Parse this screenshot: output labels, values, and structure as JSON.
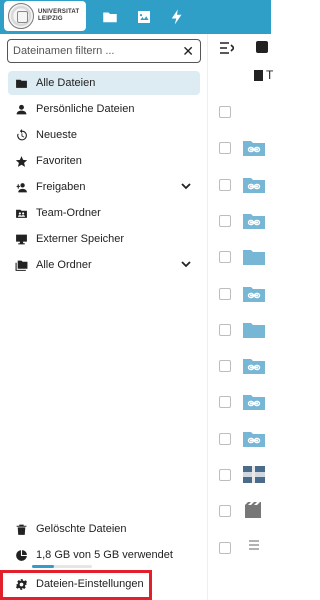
{
  "header": {
    "logo_text_line1": "UNIVERSITAT",
    "logo_text_line2": "LEIPZIG",
    "apps": [
      {
        "icon": "folder-icon"
      },
      {
        "icon": "image-icon"
      },
      {
        "icon": "lightning-icon"
      }
    ],
    "colors": {
      "header_bg": "#2f9fc8",
      "active_item_bg": "#ddebf3",
      "highlight_border": "#e0202a",
      "folder_color": "#77b6d4"
    }
  },
  "sidebar": {
    "search": {
      "placeholder": "Dateinamen filtern ...",
      "value": ""
    },
    "items": [
      {
        "label": "Alle Dateien",
        "icon": "folder-icon",
        "active": true
      },
      {
        "label": "Persönliche Dateien",
        "icon": "user-icon"
      },
      {
        "label": "Neueste",
        "icon": "history-icon"
      },
      {
        "label": "Favoriten",
        "icon": "star-icon"
      },
      {
        "label": "Freigaben",
        "icon": "share-user-icon",
        "expandable": true
      },
      {
        "label": "Team-Ordner",
        "icon": "team-folder-icon"
      },
      {
        "label": "Externer Speicher",
        "icon": "external-storage-icon"
      },
      {
        "label": "Alle Ordner",
        "icon": "folders-icon",
        "expandable": true
      }
    ],
    "footer": {
      "trash_label": "Gelöschte Dateien",
      "quota_label": "1,8 GB von 5 GB verwendet",
      "quota_fraction": 0.36,
      "settings_label": "Dateien-Einstellungen"
    }
  },
  "content": {
    "header_col_label": "T"
  }
}
